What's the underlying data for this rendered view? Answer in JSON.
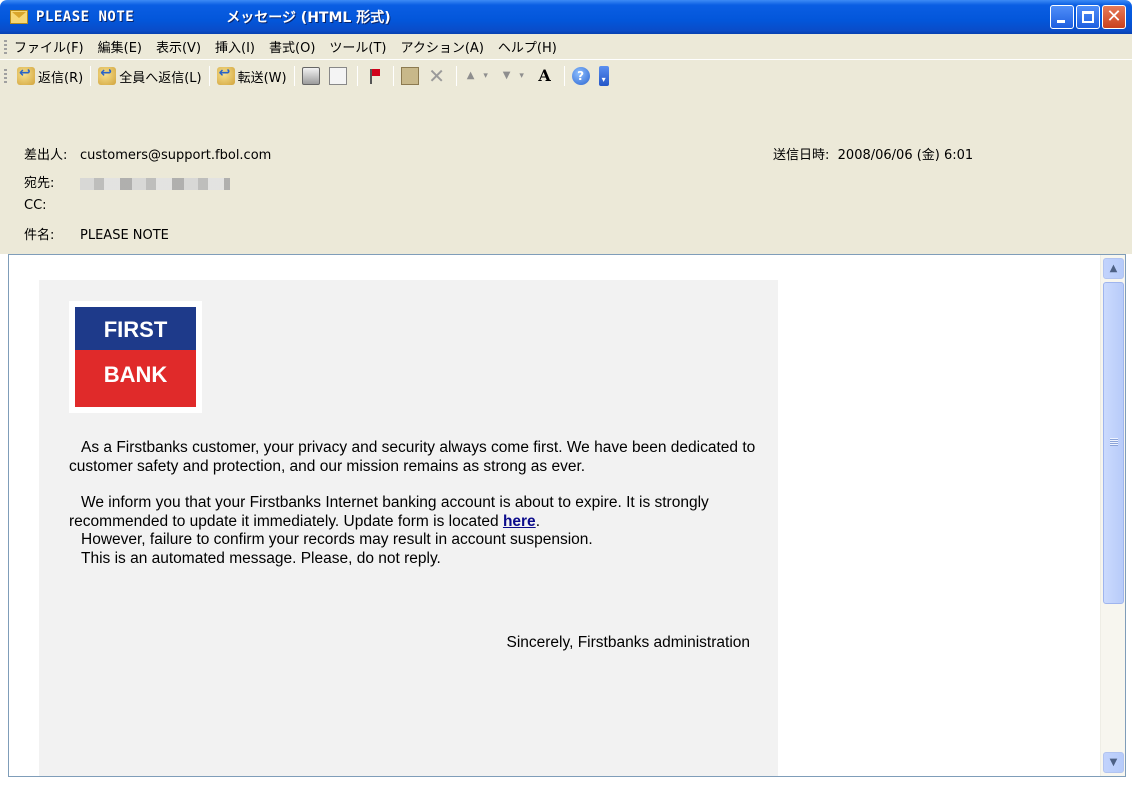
{
  "window": {
    "title": "PLEASE NOTE",
    "subtitle": "メッセージ (HTML 形式)",
    "minimize_label": "",
    "close_label": "✕"
  },
  "menu": [
    "ファイル(F)",
    "編集(E)",
    "表示(V)",
    "挿入(I)",
    "書式(O)",
    "ツール(T)",
    "アクション(A)",
    "ヘルプ(H)"
  ],
  "toolbar": {
    "reply": "返信(R)",
    "reply_all": "全員へ返信(L)",
    "forward": "転送(W)",
    "font_glyph": "A",
    "help_glyph": "?"
  },
  "header": {
    "from_label": "差出人:",
    "from_value": "customers@support.fbol.com",
    "to_label": "宛先:",
    "cc_label": "CC:",
    "subject_label": "件名:",
    "subject_value": "PLEASE NOTE",
    "sent_label": "送信日時:",
    "sent_value": "2008/06/06 (金) 6:01"
  },
  "message": {
    "logo_top": "FIRST",
    "logo_bottom": "BANK",
    "p1": "As a Firstbanks customer, your privacy and security always come first. We have been dedicated to customer safety and protection, and our mission remains as strong as ever.",
    "p2_before": "We inform you that your Firstbanks Internet banking account is about to expire. It is strongly recommended to update it immediately. Update form is located ",
    "p2_link": "here",
    "p2_after": ".",
    "p3": "However, failure to confirm your records may result in account suspension.",
    "p4": "This is an automated message. Please, do not reply.",
    "signoff": "Sincerely, Firstbanks administration"
  }
}
